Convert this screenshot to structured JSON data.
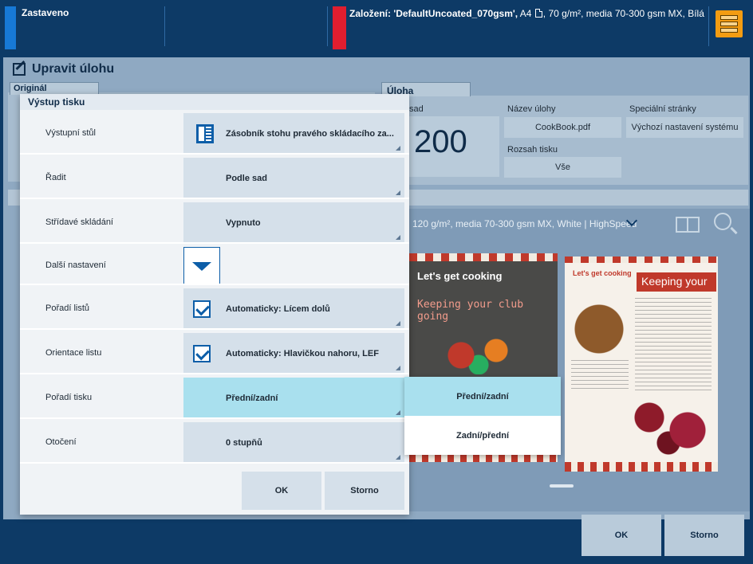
{
  "status": {
    "left_text": "Zastaveno",
    "mid_bold": "Založení: 'DefaultUncoated_070gsm',",
    "mid_rest": " A4 ",
    "mid_rest2": ", 70 g/m², media 70-300 gsm MX, Bílá",
    "colors": {
      "left_bar": "#1779d6",
      "right_bar": "#e01e2f",
      "tray_button": "#f39c12"
    }
  },
  "window": {
    "title": "Upravit úlohu",
    "tab_original": "Originál",
    "tab_job": "Úloha",
    "label_sad": "sad",
    "copies": "200",
    "label_job_name": "Název úlohy",
    "job_name": "CookBook.pdf",
    "label_special_pages": "Speciální stránky",
    "special_pages": "Výchozí nastavení systému",
    "label_print_range": "Rozsah tisku",
    "print_range": "Vše",
    "media_summary": "120 g/m², media 70-300 gsm MX, White | HighSpeed",
    "bottom_ok": "OK",
    "bottom_cancel": "Storno",
    "preview_left": {
      "title": "Let's get cooking",
      "subtitle": "Keeping your club going"
    },
    "preview_right": {
      "title": "Let's get cooking",
      "banner": "Keeping your"
    }
  },
  "dialog": {
    "title": "Výstup tisku",
    "rows": [
      {
        "label": "Výstupní stůl",
        "value": "Zásobník stohu pravého skládacího za..."
      },
      {
        "label": "Řadit",
        "value": "Podle sad"
      },
      {
        "label": "Střídavé skládání",
        "value": "Vypnuto"
      },
      {
        "label": "Další nastavení",
        "value": ""
      },
      {
        "label": "Pořadí listů",
        "value": "Automaticky: Lícem dolů"
      },
      {
        "label": "Orientace listu",
        "value": "Automaticky: Hlavičkou nahoru, LEF"
      },
      {
        "label": "Pořadí tisku",
        "value": "Přední/zadní"
      },
      {
        "label": "Otočení",
        "value": "0 stupňů"
      }
    ],
    "ok": "OK",
    "cancel": "Storno"
  },
  "dropdown": {
    "options": [
      "Přední/zadní",
      "Zadní/přední"
    ],
    "selected_index": 0
  }
}
